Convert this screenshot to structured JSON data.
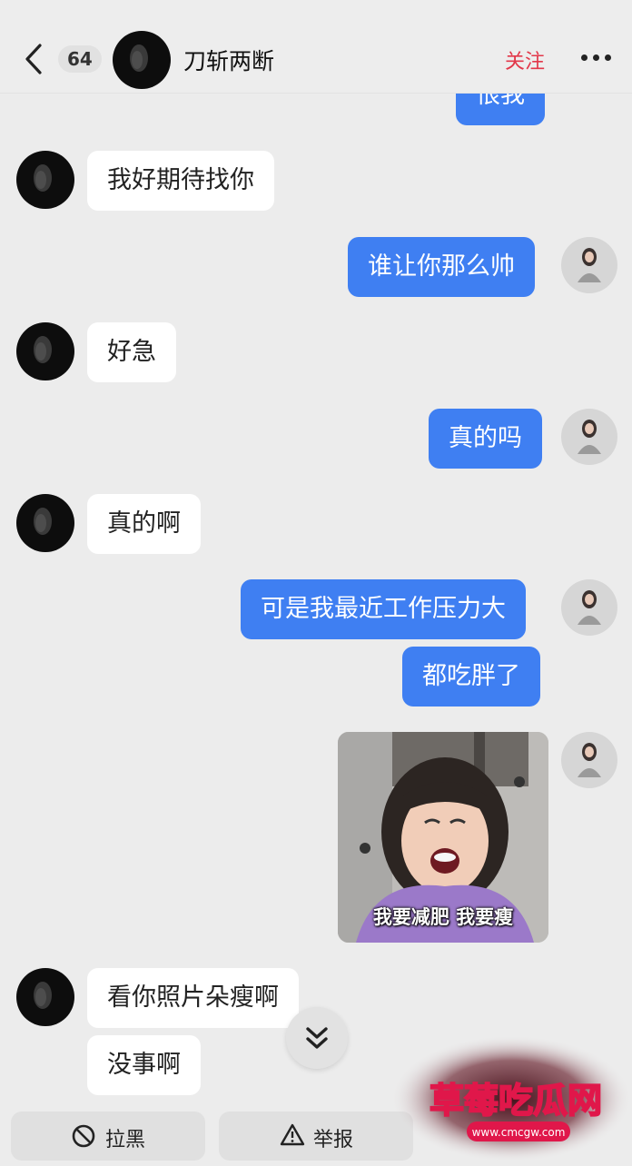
{
  "header": {
    "unread_count": "64",
    "contact_name": "刀斩两断",
    "follow_label": "关注"
  },
  "messages": [
    {
      "side": "right",
      "text": "恨我",
      "partial": true
    },
    {
      "side": "left",
      "text": "我好期待找你"
    },
    {
      "side": "right",
      "text": "谁让你那么帅"
    },
    {
      "side": "left",
      "text": "好急"
    },
    {
      "side": "right",
      "text": "真的吗"
    },
    {
      "side": "left",
      "text": "真的啊"
    },
    {
      "side": "right",
      "text": "可是我最近工作压力大"
    },
    {
      "side": "right",
      "text": "都吃胖了"
    },
    {
      "side": "right",
      "type": "sticker",
      "caption": "我要减肥 我要瘦"
    },
    {
      "side": "left",
      "text": "看你照片朵瘦啊"
    },
    {
      "side": "left",
      "text": "没事啊"
    }
  ],
  "actions": {
    "block_label": "拉黑",
    "report_label": "举报"
  },
  "watermark": {
    "text": "草莓吃瓜网",
    "url": "www.cmcgw.com"
  },
  "colors": {
    "sent_bubble": "#3f7ff2",
    "received_bubble": "#ffffff",
    "follow": "#e2384a",
    "background": "#ececec"
  },
  "icons": [
    "back-arrow-icon",
    "more-dots-icon",
    "scroll-down-chevron-icon",
    "block-icon",
    "warning-icon"
  ]
}
